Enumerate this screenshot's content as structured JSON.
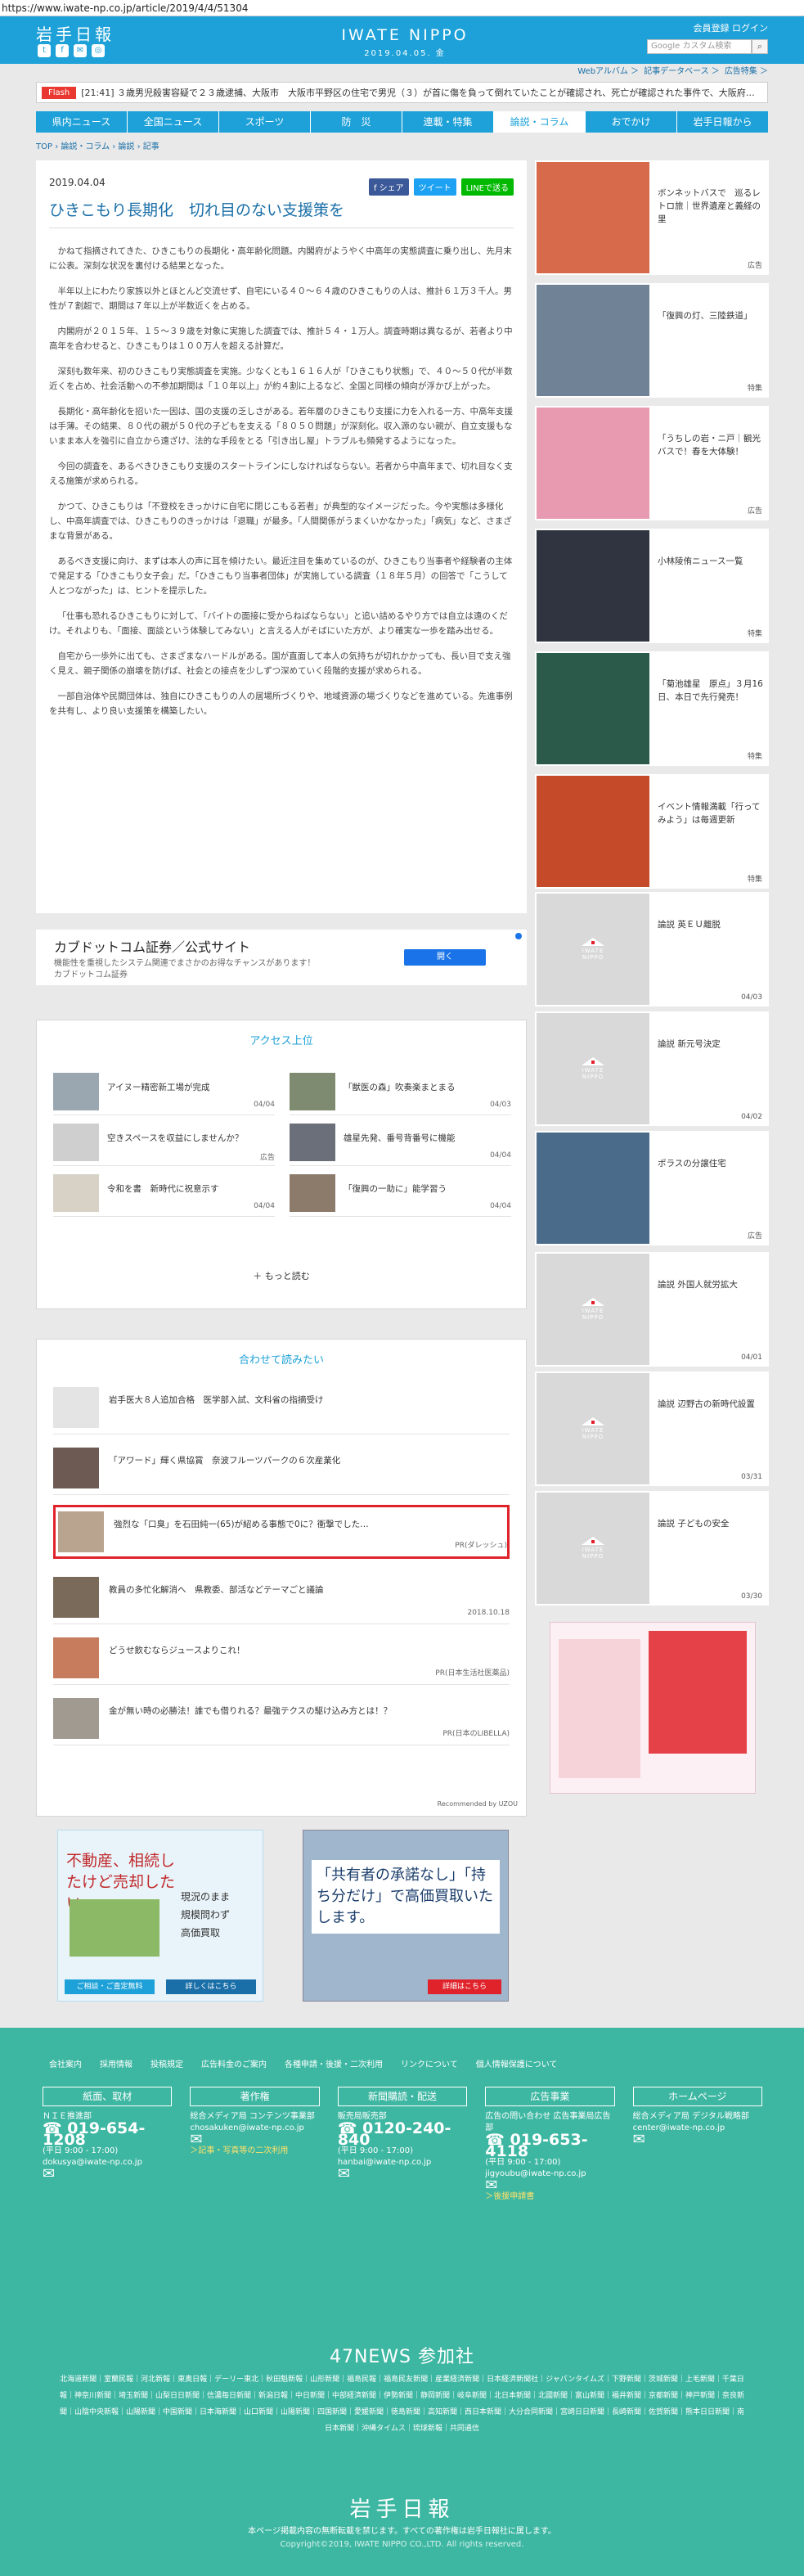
{
  "url": "https://www.iwate-np.co.jp/article/2019/4/4/51304",
  "header": {
    "logo": "岩手日報",
    "center_title": "IWATE NIPPO",
    "center_date": "2019.04.05. 金",
    "member_links": "会員登録  ログイン",
    "search_placeholder": "Google カスタム検索",
    "social": [
      "t",
      "f",
      "m",
      "i"
    ]
  },
  "subnav": [
    "Webアルバム ＞",
    "記事データベース ＞",
    "広告特集 ＞"
  ],
  "flash": {
    "label": "Flash",
    "text": "[21:41] ３歳男児殺害容疑で２３歳逮捕、大阪市　大阪市平野区の住宅で男児（３）が首に傷を負って倒れていたことが確認され、死亡が確認された事件で、大阪府…"
  },
  "gnav": [
    "県内ニュース",
    "全国ニュース",
    "スポーツ",
    "防　災",
    "連載・特集",
    "論説・コラム",
    "おでかけ",
    "岩手日報から"
  ],
  "gnav_active": 5,
  "breadcrumb": "TOP › 論説・コラム › 論説 › 記事",
  "article": {
    "date": "2019.04.04",
    "title": "ひきこもり長期化　切れ目のない支援策を",
    "share": [
      "f シェア",
      "ツイート",
      "LINEで送る"
    ],
    "paragraphs": [
      "かねて指摘されてきた、ひきこもりの長期化・高年齢化問題。内閣府がようやく中高年の実態調査に乗り出し、先月末に公表。深刻な状況を裏付ける結果となった。",
      "半年以上にわたり家族以外とほとんど交流せず、自宅にいる４０～６４歳のひきこもりの人は、推計６１万３千人。男性が７割超で、期間は７年以上が半数近くを占める。",
      "内閣府が２０１５年、１５～３９歳を対象に実施した調査では、推計５４・１万人。調査時期は異なるが、若者より中高年を合わせると、ひきこもりは１００万人を超える計算だ。",
      "深刻も数年来、初のひきこもり実態調査を実施。少なくとも１６１６人が「ひきこもり状態」で、４０～５０代が半数近くを占め、社会活動への不参加期間は「１０年以上」が約４割に上るなど、全国と同様の傾向が浮かび上がった。",
      "長期化・高年齢化を招いた一因は、国の支援の乏しさがある。若年層のひきこもり支援に力を入れる一方、中高年支援は手薄。その結果、８０代の親が５０代の子どもを支える「８０５０問題」が深刻化。収入源のない親が、自立支援もないまま本人を強引に自立から遠ざけ、法的な手段をとる「引き出し屋」トラブルも頻発するようになった。",
      "今回の調査を、あるべきひきこもり支援のスタートラインにしなければならない。若者から中高年まで、切れ目なく支える施策が求められる。",
      "かつて、ひきこもりは「不登校をきっかけに自宅に閉じこもる若者」が典型的なイメージだった。今や実態は多様化し、中高年調査では、ひきこもりのきっかけは「退職」が最多。「人間関係がうまくいかなかった」「病気」など、さまざまな背景がある。",
      "あるべき支援に向け、まずは本人の声に耳を傾けたい。最近注目を集めているのが、ひきこもり当事者や経験者の主体で発足する「ひきこもり女子会」だ。「ひきこもり当事者団体」が実施している調査（１８年５月）の回答で「こうして人とつながった」は、ヒントを提示した。",
      "「仕事も恐れるひきこもりに対して、「バイトの面接に受からねばならない」と追い詰めるやり方では自立は遠のくだけ。それよりも、「面接、面談という体験してみない」と言える人がそばにいた方が、より確実な一歩を踏み出せる。",
      "自宅から一歩外に出ても、さまざまなハードルがある。国が直面して本人の気持ちが切れかかっても、長い目で支え強く見え、親子関係の崩壊を防げば、社会との接点を少しずつ深めていく段階的支援が求められる。",
      "一部自治体や民間団体は、独自にひきこもりの人の居場所づくりや、地域資源の場づくりなどを進めている。先進事例を共有し、より良い支援策を構築したい。"
    ]
  },
  "ad_bar": {
    "title": "カブドットコム証券／公式サイト",
    "line1": "機能性を重視したシステム関連でまさかのお得なチャンスがあります！",
    "line2": "カブドットコム証券",
    "button": "開く"
  },
  "ranking": {
    "heading": "アクセス上位",
    "items": [
      {
        "text": "アイヌー精密新工場が完成",
        "date": "04/04"
      },
      {
        "text": "「獣医の森」吹奏楽まとまる",
        "date": "04/03"
      },
      {
        "text": "空きスペースを収益にしませんか？",
        "date": "広告"
      },
      {
        "text": "雄星先発、番号背番号に機能",
        "date": "04/04"
      },
      {
        "text": "令和を書　新時代に祝意示す",
        "date": "04/04"
      },
      {
        "text": "「復興の一助に」能学習う",
        "date": "04/04"
      }
    ],
    "more": "もっと読む"
  },
  "related": {
    "heading": "合わせて読みたい",
    "items": [
      {
        "text": "岩手医大８人追加合格　医学部入試、文科省の指摘受け",
        "src": ""
      },
      {
        "text": "「アワード」輝く県協賞　奈波フルーツパークの６次産業化",
        "src": ""
      },
      {
        "text": "強烈な「口臭」を石田純一(65)が紹める事態で0に？衝撃でした…",
        "src": "PR(ダレッシュ)"
      },
      {
        "text": "教員の多忙化解消へ　県教委、部活などテーマごと議論",
        "src": "2018.10.18"
      },
      {
        "text": "どうせ飲むならジュースよりこれ！",
        "src": "PR(日本生活社医薬品)"
      },
      {
        "text": "金が無い時の必勝法！誰でも借りれる？最強テクスの駆け込み方とは！？",
        "src": "PR(日本のLIBELLA)"
      }
    ],
    "recommended_by": "Recommended by UZOU"
  },
  "bottom_ads": {
    "left": {
      "title": "不動産、相続したけど売却したい",
      "opts": [
        "現況のまま",
        "規模問わず",
        "高価買取"
      ],
      "btn1": "ご相談・ご査定無料",
      "btn2": "詳しくはこちら"
    },
    "right": {
      "title": "「共有者の承諾なし」「持ち分だけ」で高価買取いたします。",
      "btn": "詳細はこちら"
    }
  },
  "sidebar": [
    {
      "text": "ボンネットバスで　巡るレトロ旅｜世界遺産と義経の里",
      "tag": "広告",
      "type": "img"
    },
    {
      "text": "「復興の灯、三陸鉄道」",
      "tag": "特集",
      "type": "img"
    },
    {
      "text": "「うちしの岩・ニ戸｜観光バスで！春を大体験！",
      "tag": "広告",
      "type": "img"
    },
    {
      "text": "小林陵侑ニュース一覧",
      "tag": "特集",
      "type": "img"
    },
    {
      "text": "「菊池雄星　原点」３月16日、本日で先行発売！",
      "tag": "特集",
      "type": "img"
    },
    {
      "text": "イベント情報満載「行ってみよう」は毎週更新",
      "tag": "特集",
      "type": "img"
    },
    {
      "text": "論説 英ＥＵ離脱",
      "tag": "04/03",
      "type": "logo"
    },
    {
      "text": "論説 新元号決定",
      "tag": "04/02",
      "type": "logo"
    },
    {
      "text": "ポラスの分譲住宅",
      "tag": "広告",
      "type": "img"
    },
    {
      "text": "論説 外国人就労拡大",
      "tag": "04/01",
      "type": "logo"
    },
    {
      "text": "論説 辺野古の新時代設置",
      "tag": "03/31",
      "type": "logo"
    },
    {
      "text": "論説 子どもの安全",
      "tag": "03/30",
      "type": "logo"
    }
  ],
  "footer": {
    "links": [
      "会社案内",
      "採用情報",
      "投稿規定",
      "広告料金のご案内",
      "各種申請・後援・二次利用",
      "リンクについて",
      "個人情報保護について"
    ],
    "cols": [
      {
        "head": "紙面、取材",
        "sub": "ＮＩＥ推進部",
        "tel": "019-654-1208",
        "hours": "(平日 9:00 - 17:00)",
        "mail": "dokusya@iwate-np.co.jp",
        "extra": ""
      },
      {
        "head": "著作権",
        "sub": "総合メディア局 コンテンツ事業部",
        "tel": "019-653-4113",
        "hours": "(平日 9:00 - 17:00)",
        "mail": "chosakuken@iwate-np.co.jp",
        "extra": "＞記事・写真等の二次利用"
      },
      {
        "head": "新聞購読・配送",
        "sub": "販売局販売部",
        "tel": "0120-240-840",
        "hours": "(平日 9:00 - 17:00)",
        "mail": "hanbai@iwate-np.co.jp",
        "extra": ""
      },
      {
        "head": "広告事業",
        "sub": "広告の問い合わせ 広告事業局広告部",
        "tel": "019-653-4118",
        "hours": "(平日 9:00 - 17:00)",
        "mail": "jigyoubu@iwate-np.co.jp",
        "extra": "＞後援申請書"
      },
      {
        "head": "ホームページ",
        "sub": "総合メディア局 デジタル戦略部",
        "tel": "",
        "hours": "",
        "mail": "center@iwate-np.co.jp",
        "extra": ""
      }
    ],
    "news47": "47NEWS 参加社",
    "partners": "北海道新聞｜室蘭民報｜河北新報｜東奥日報｜デーリー東北｜秋田魁新報｜山形新聞｜福島民報｜福島民友新聞｜産業経済新聞｜日本経済新聞社｜ジャパンタイムズ｜下野新聞｜茨城新聞｜上毛新聞｜千葉日報｜神奈川新聞｜埼玉新聞｜山梨日日新聞｜信濃毎日新聞｜新潟日報｜中日新聞｜中部経済新聞｜伊勢新聞｜静岡新聞｜岐阜新聞｜北日本新聞｜北國新聞｜富山新聞｜福井新聞｜京都新聞｜神戸新聞｜奈良新聞｜山陰中央新報｜山陽新聞｜中国新聞｜日本海新聞｜山口新聞｜山陽新聞｜四国新聞｜愛媛新聞｜徳島新聞｜高知新聞｜西日本新聞｜大分合同新聞｜宮崎日日新聞｜長崎新聞｜佐賀新聞｜熊本日日新聞｜南日本新聞｜沖縄タイムス｜琉球新報｜共同通信",
    "logo": "岩手日報",
    "copy1": "本ページ掲載内容の無断転載を禁じます。すべての著作権は岩手日報社に属します。",
    "copy2": "Copyright©2019, IWATE NIPPO CO.,LTD. All rights reserved."
  }
}
